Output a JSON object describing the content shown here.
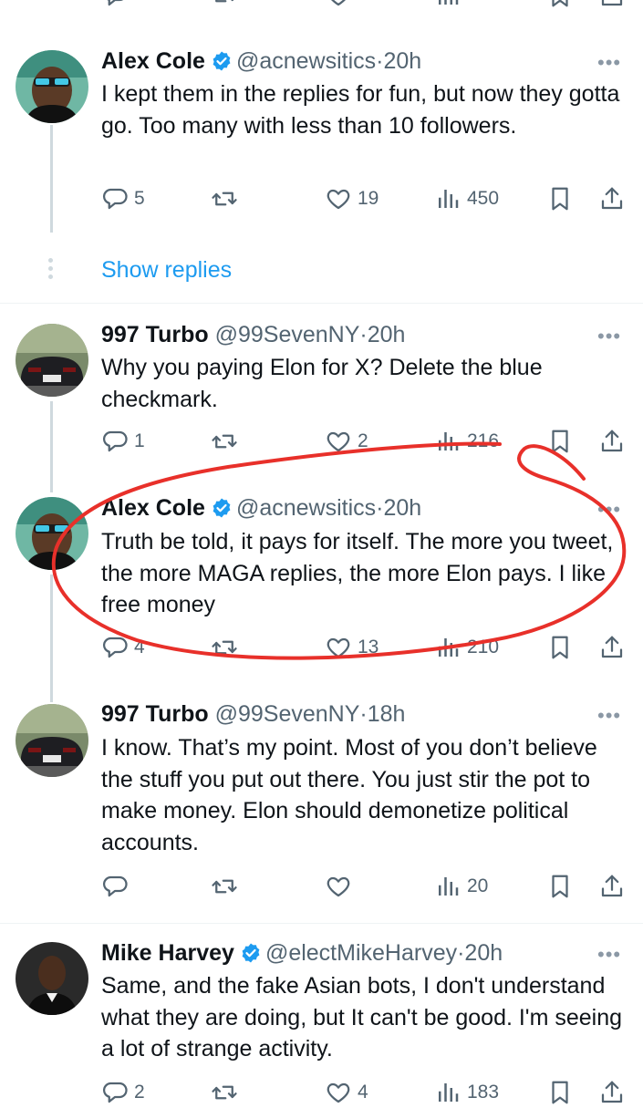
{
  "colors": {
    "accent": "#1d9bf0",
    "secondary_text": "#536471",
    "annotation": "#e8302a"
  },
  "top_partial_row": {
    "icons": [
      "reply-icon",
      "retweet-icon",
      "like-icon",
      "views-icon",
      "bookmark-icon",
      "share-icon"
    ]
  },
  "show_replies": "Show replies",
  "tweets": [
    {
      "name": "Alex Cole",
      "verified": true,
      "handle": "@acnewsitics",
      "dot": "·",
      "time": "20h",
      "text": "I kept them in the replies for fun, but now they gotta go. Too many with less than 10 followers.",
      "replies": "5",
      "retweets": "",
      "likes": "19",
      "views": "450"
    },
    {
      "name": "997 Turbo",
      "verified": false,
      "handle": "@99SevenNY",
      "dot": "·",
      "time": "20h",
      "text": "Why you paying Elon for X? Delete the blue checkmark.",
      "replies": "1",
      "retweets": "",
      "likes": "2",
      "views": "216"
    },
    {
      "name": "Alex Cole",
      "verified": true,
      "handle": "@acnewsitics",
      "dot": "·",
      "time": "20h",
      "text": "Truth be told, it pays for itself. The more you tweet, the more MAGA replies, the more Elon pays. I like free money",
      "replies": "4",
      "retweets": "",
      "likes": "13",
      "views": "210"
    },
    {
      "name": "997 Turbo",
      "verified": false,
      "handle": "@99SevenNY",
      "dot": "·",
      "time": "18h",
      "text": "I know. That’s my point. Most of you don’t believe the stuff you put out there. You just stir the pot to make money. Elon should demonetize political accounts.",
      "replies": "",
      "retweets": "",
      "likes": "",
      "views": "20"
    },
    {
      "name": "Mike Harvey",
      "verified": true,
      "handle": "@electMikeHarvey",
      "dot": "·",
      "time": "20h",
      "text": "Same, and the fake Asian bots, I don't understand what they are doing, but It can't be good. I'm seeing a lot of strange activity.",
      "replies": "2",
      "retweets": "",
      "likes": "4",
      "views": "183"
    }
  ]
}
